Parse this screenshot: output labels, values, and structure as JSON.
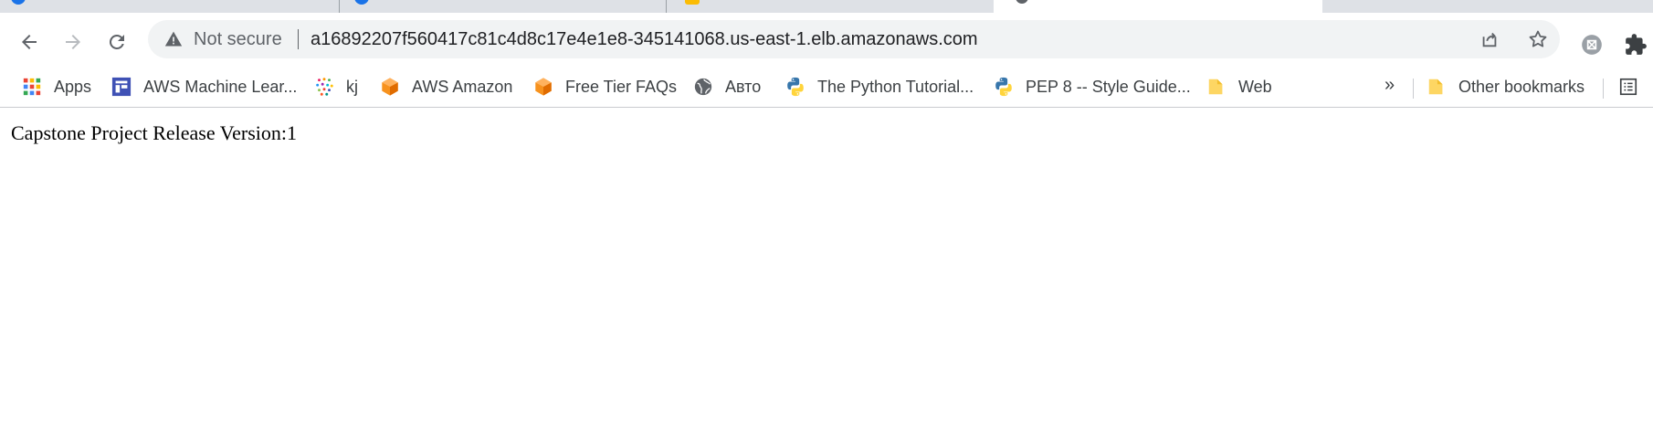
{
  "browser": {
    "toolbar": {
      "back_icon": "arrow-left-icon",
      "forward_icon": "arrow-right-icon",
      "reload_icon": "reload-icon",
      "security_label": "Not secure",
      "url": "a16892207f560417c81c4d8c17e4e1e8-345141068.us-east-1.elb.amazonaws.com",
      "share_icon": "share-icon",
      "bookmark_icon": "star-icon",
      "extensions": [
        "extension-icon",
        "puzzle-icon"
      ]
    },
    "bookmarks": {
      "items": [
        {
          "label": "Apps",
          "icon": "apps-grid-icon"
        },
        {
          "label": "AWS Machine Lear...",
          "icon": "aws-ml-icon"
        },
        {
          "label": "kj",
          "icon": "colorful-dots-icon"
        },
        {
          "label": "AWS Amazon",
          "icon": "aws-cube-icon"
        },
        {
          "label": "Free Tier FAQs",
          "icon": "aws-cube-icon"
        },
        {
          "label": "Авто",
          "icon": "globe-icon"
        },
        {
          "label": "The Python Tutorial...",
          "icon": "python-icon"
        },
        {
          "label": "PEP 8 -- Style Guide...",
          "icon": "python-icon"
        },
        {
          "label": "Web",
          "icon": "folder-icon"
        }
      ],
      "overflow_label": "»",
      "other_bookmarks": {
        "label": "Other bookmarks",
        "icon": "folder-icon"
      },
      "reading_list_icon": "reading-list-icon"
    },
    "colors": {
      "tabstrip": "#dee1e6",
      "omnibox": "#f1f3f4",
      "aws_orange": "#f7921e",
      "folder_yellow": "#fdd663",
      "python_blue": "#3776ab",
      "python_yellow": "#ffd43b"
    }
  },
  "page": {
    "text": "Capstone Project Release Version:1"
  }
}
